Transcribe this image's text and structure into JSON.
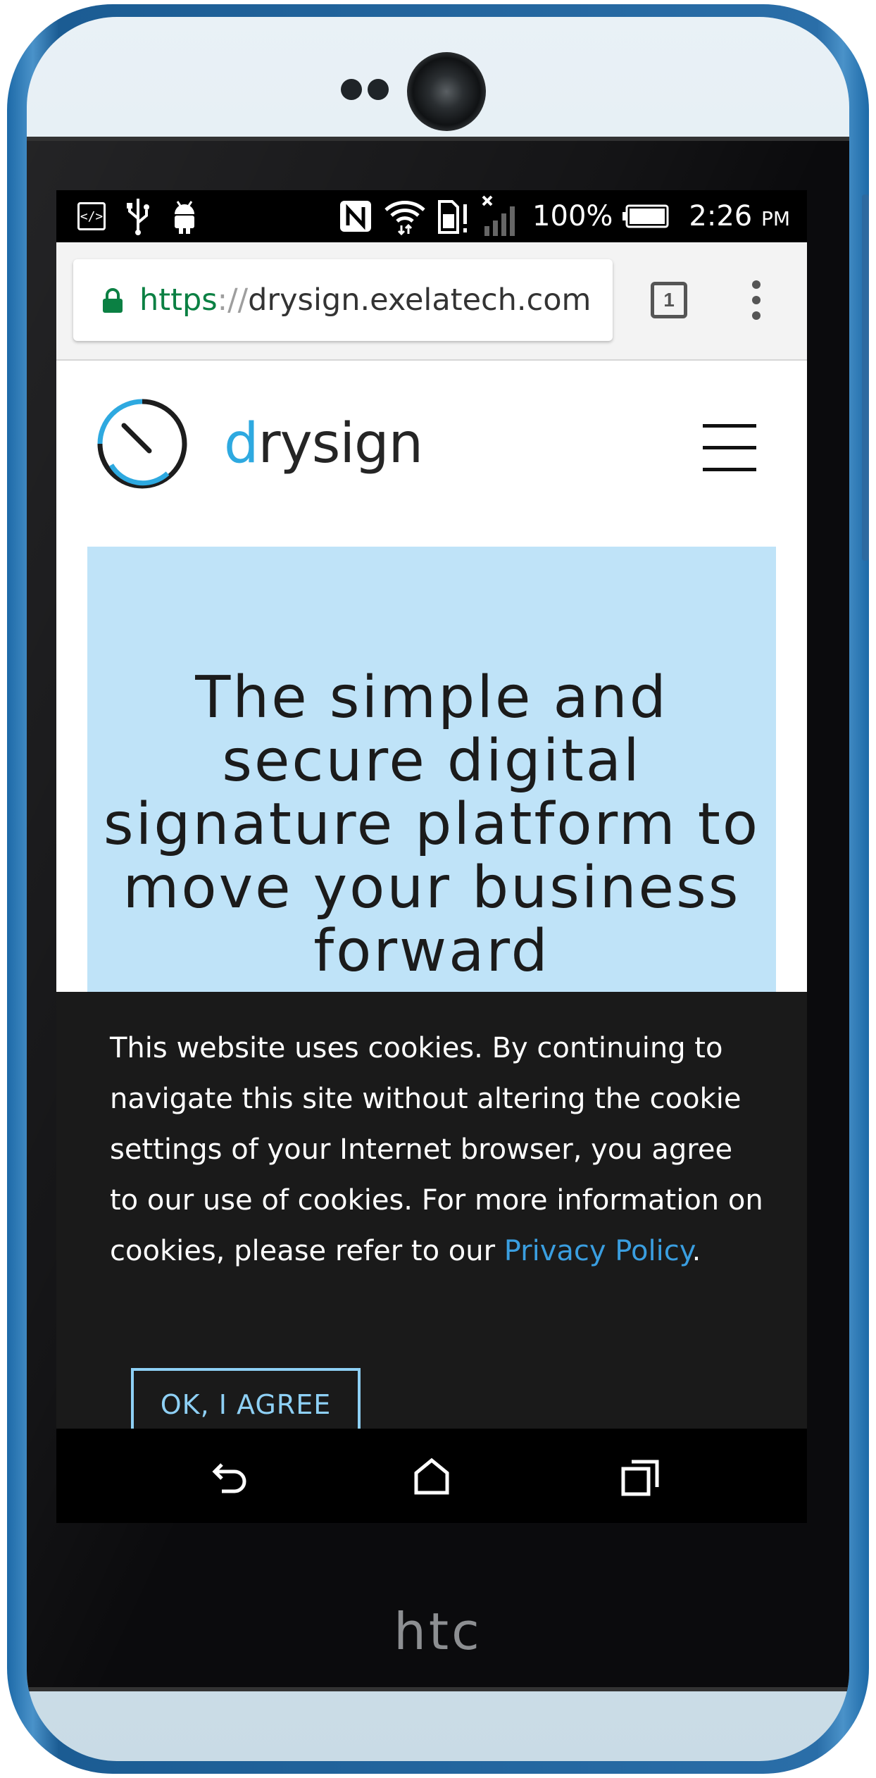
{
  "status_bar": {
    "icons": [
      "developer-icon",
      "usb-icon",
      "android-debug-icon",
      "nfc-icon",
      "wifi-icon",
      "sd-card-alert-icon",
      "no-signal-icon",
      "battery-icon"
    ],
    "battery": "100%",
    "time": "2:26",
    "time_suffix": "PM"
  },
  "browser": {
    "url_scheme": "https",
    "url_separator": "://",
    "url_host": "drysign.exelatech.com",
    "tab_count": "1",
    "lock_color": "#0b8043"
  },
  "site": {
    "logo_word_first": "d",
    "logo_word_rest": "rysign",
    "brand_color": "#2ea9e0",
    "hero_title": "The simple and secure digital signature platform to move your business forward"
  },
  "cookie_banner": {
    "text": "This website uses cookies. By continuing to navigate this site without altering the cookie settings of your Internet browser, you agree to our use of cookies. For more information on cookies, please refer to our ",
    "link_label": "Privacy Policy",
    "text_end": ".",
    "agree_label": "OK, I AGREE"
  },
  "nav_bar": {
    "buttons": [
      "back-icon",
      "home-icon",
      "recents-icon"
    ]
  },
  "device": {
    "brand": "htc"
  }
}
